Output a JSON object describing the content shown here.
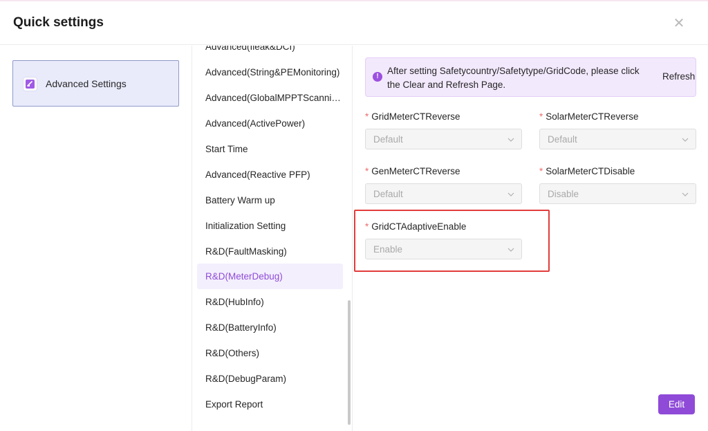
{
  "dialog": {
    "title": "Quick settings"
  },
  "left": {
    "advanced_label": "Advanced Settings"
  },
  "menu": {
    "items": [
      "Advanced(Ileak&DCI)",
      "Advanced(String&PEMonitoring)",
      "Advanced(GlobalMPPTScanning)",
      "Advanced(ActivePower)",
      "Start Time",
      "Advanced(Reactive PFP)",
      "Battery Warm up",
      "Initialization Setting",
      "R&D(FaultMasking)",
      "R&D(MeterDebug)",
      "R&D(HubInfo)",
      "R&D(BatteryInfo)",
      "R&D(Others)",
      "R&D(DebugParam)",
      "Export Report"
    ],
    "active_index": 9
  },
  "notice": {
    "text": "After setting Safetycountry/Safetytype/GridCode, please click the Clear and Refresh Page.",
    "refresh_label": "Refresh"
  },
  "fields": [
    {
      "label": "GridMeterCTReverse",
      "value": "Default"
    },
    {
      "label": "SolarMeterCTReverse",
      "value": "Default"
    },
    {
      "label": "GenMeterCTReverse",
      "value": "Default"
    },
    {
      "label": "SolarMeterCTDisable",
      "value": "Disable"
    },
    {
      "label": "GridCTAdaptiveEnable",
      "value": "Enable"
    }
  ],
  "required_mark": "*",
  "actions": {
    "edit_label": "Edit"
  },
  "colors": {
    "accent": "#8f4bd8",
    "highlight": "#e23b3b",
    "notice_bg": "#f3e9fd"
  },
  "icons": {
    "close": "close-icon",
    "info": "info-icon",
    "chevron": "chevron-down-icon",
    "settings": "settings-doc-icon"
  }
}
